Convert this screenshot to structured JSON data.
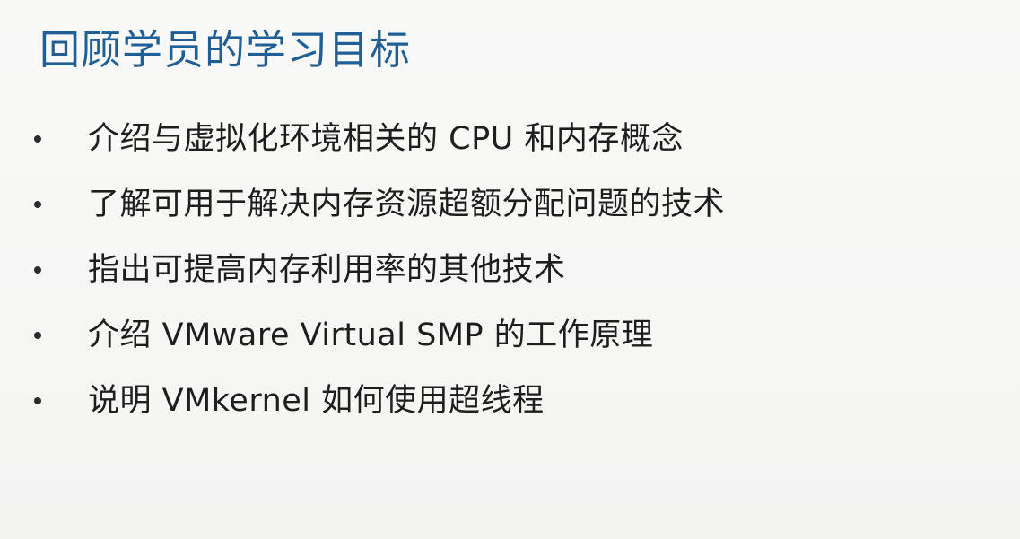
{
  "slide": {
    "title": "回顾学员的学习目标",
    "bullets": [
      "介绍与虚拟化环境相关的 CPU 和内存概念",
      "了解可用于解决内存资源超额分配问题的技术",
      "指出可提高内存利用率的其他技术",
      "介绍 VMware Virtual SMP 的工作原理",
      "说明 VMkernel 如何使用超线程"
    ]
  },
  "colors": {
    "title": "#1f5f96",
    "body_text": "#1e1e1e",
    "background": "#f7f7f6"
  }
}
